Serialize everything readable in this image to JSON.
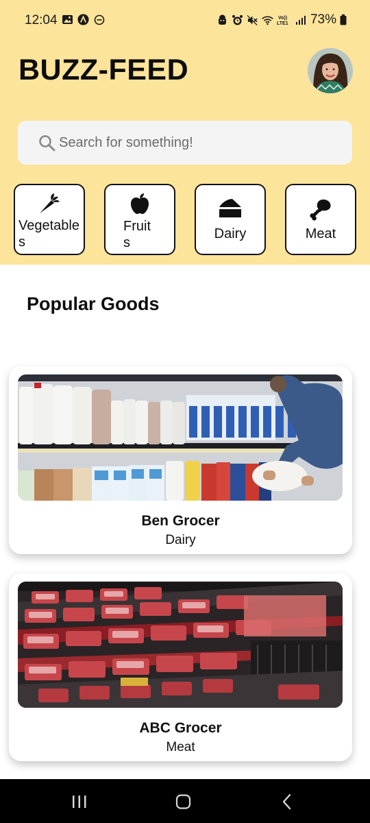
{
  "status_bar": {
    "time": "12:04",
    "battery": "73%",
    "icons": [
      "gallery-icon",
      "app-a-icon",
      "dnd-icon",
      "android-icon",
      "alarm-icon",
      "mute-icon",
      "wifi-icon",
      "volte-icon",
      "signal-icon",
      "battery-icon"
    ]
  },
  "header": {
    "title": "BUZZ-FEED",
    "avatar": "profile-photo",
    "background_color": "#fde49b"
  },
  "search": {
    "placeholder": "Search for something!",
    "value": ""
  },
  "categories": [
    {
      "label_line1": "Vegetable",
      "label_line2": "s",
      "icon": "carrot-icon"
    },
    {
      "label_line1": "Fruit",
      "label_line2": "s",
      "icon": "apple-icon"
    },
    {
      "label_line1": "Dairy",
      "icon": "cheese-icon"
    },
    {
      "label_line1": "Meat",
      "icon": "drumstick-icon"
    }
  ],
  "section": {
    "title": "Popular Goods"
  },
  "goods": [
    {
      "name": "Ben Grocer",
      "category": "Dairy",
      "image": "dairy-aisle-photo"
    },
    {
      "name": "ABC Grocer",
      "category": "Meat",
      "image": "meat-counter-photo"
    }
  ],
  "nav_bar": {
    "buttons": [
      "recent-apps-icon",
      "home-icon",
      "back-icon"
    ]
  }
}
